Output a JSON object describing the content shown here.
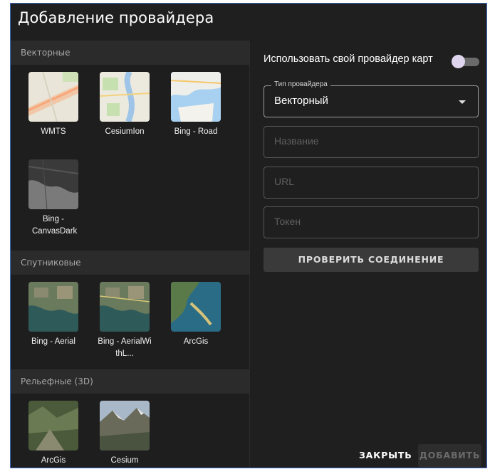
{
  "dialog": {
    "title": "Добавление провайдера"
  },
  "sections": {
    "vector": {
      "header": "Векторные",
      "items": [
        {
          "label": "WMTS",
          "icon": "wmts-map-thumbnail"
        },
        {
          "label": "CesiumIon",
          "icon": "cesiumion-map-thumbnail"
        },
        {
          "label": "Bing - Road",
          "icon": "bing-road-map-thumbnail"
        },
        {
          "label": "Bing - CanvasDark",
          "icon": "bing-canvasdark-map-thumbnail"
        }
      ]
    },
    "satellite": {
      "header": "Спутниковые",
      "items": [
        {
          "label": "Bing - Aerial",
          "icon": "bing-aerial-thumbnail"
        },
        {
          "label": "Bing - AerialWithL...",
          "icon": "bing-aerial-labels-thumbnail"
        },
        {
          "label": "ArcGis",
          "icon": "arcgis-satellite-thumbnail"
        }
      ]
    },
    "relief": {
      "header": "Рельефные (3D)",
      "items": [
        {
          "label": "ArcGis",
          "icon": "arcgis-terrain-thumbnail"
        },
        {
          "label": "Cesium",
          "icon": "cesium-terrain-thumbnail"
        }
      ]
    }
  },
  "form": {
    "toggle_label": "Использовать свой провайдер карт",
    "toggle_on": false,
    "type_legend": "Тип провайдера",
    "type_value": "Векторный",
    "name_placeholder": "Название",
    "url_placeholder": "URL",
    "token_placeholder": "Токен",
    "check_button": "ПРОВЕРИТЬ СОЕДИНЕНИЕ"
  },
  "footer": {
    "close": "ЗАКРЫТЬ",
    "add": "ДОБАВИТЬ"
  },
  "colors": {
    "background": "#1f1f1f",
    "section_header": "#2b2b2b",
    "border_accent": "#3c6cc0",
    "toggle_knob": "#e0d5ee"
  }
}
